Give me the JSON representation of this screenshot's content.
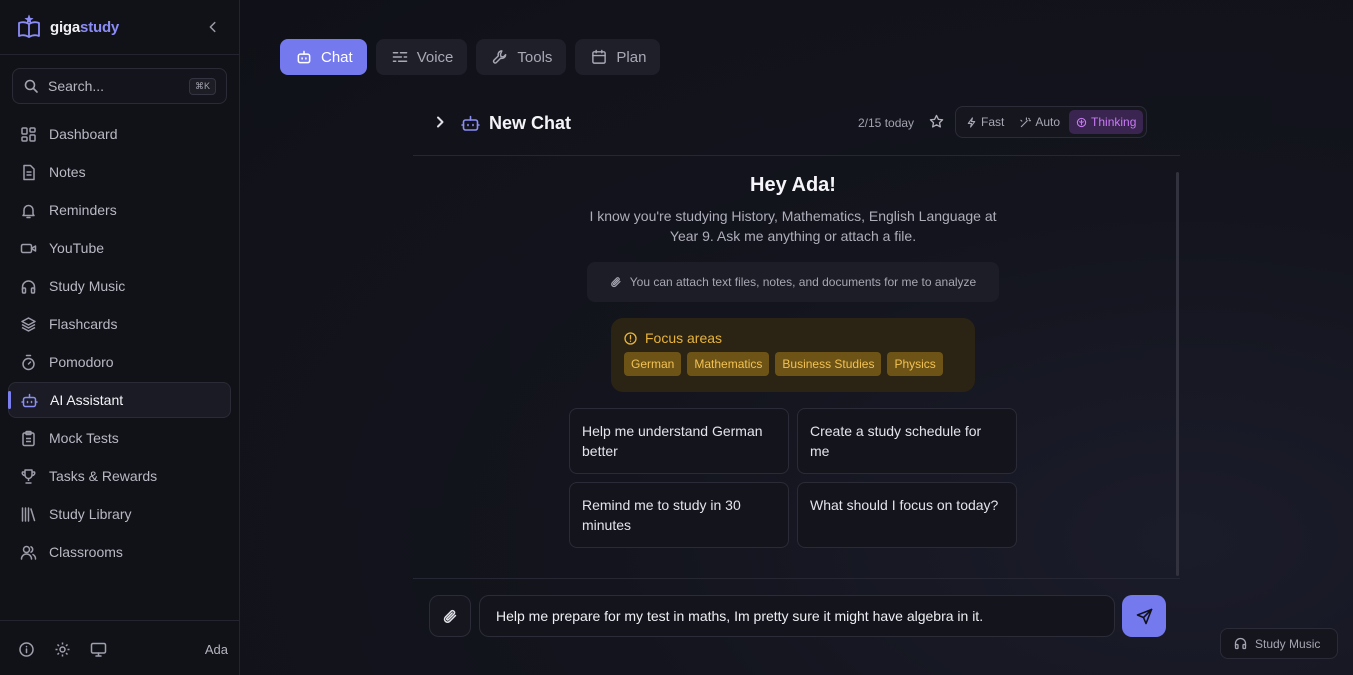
{
  "brand": {
    "part1": "giga",
    "part2": "study"
  },
  "search": {
    "placeholder": "Search...",
    "shortcut": "⌘K"
  },
  "sidebar": {
    "items": [
      {
        "label": "Dashboard",
        "icon": "dashboard-icon"
      },
      {
        "label": "Notes",
        "icon": "notes-icon"
      },
      {
        "label": "Reminders",
        "icon": "bell-icon"
      },
      {
        "label": "YouTube",
        "icon": "video-icon"
      },
      {
        "label": "Study Music",
        "icon": "headphones-icon"
      },
      {
        "label": "Flashcards",
        "icon": "layers-icon"
      },
      {
        "label": "Pomodoro",
        "icon": "timer-icon"
      },
      {
        "label": "AI Assistant",
        "icon": "bot-icon",
        "active": true
      },
      {
        "label": "Mock Tests",
        "icon": "clipboard-icon"
      },
      {
        "label": "Tasks & Rewards",
        "icon": "trophy-icon"
      },
      {
        "label": "Study Library",
        "icon": "library-icon"
      },
      {
        "label": "Classrooms",
        "icon": "users-icon"
      }
    ],
    "user": "Ada"
  },
  "mode_tabs": [
    {
      "label": "Chat",
      "icon": "bot-icon",
      "active": true
    },
    {
      "label": "Voice",
      "icon": "waves-icon"
    },
    {
      "label": "Tools",
      "icon": "wrench-icon"
    },
    {
      "label": "Plan",
      "icon": "calendar-icon"
    }
  ],
  "chat": {
    "title": "New Chat",
    "usage": "2/15 today",
    "speed_modes": [
      "Fast",
      "Auto",
      "Thinking"
    ],
    "active_speed": "Thinking",
    "greeting": "Hey Ada!",
    "intro": "I know you're studying History, Mathematics, English Language at Year 9. Ask me anything or attach a file.",
    "attach_hint": "You can attach text files, notes, and documents for me to analyze",
    "focus_title": "Focus areas",
    "focus_areas": [
      "German",
      "Mathematics",
      "Business Studies",
      "Physics"
    ],
    "suggestions": [
      "Help me understand German better",
      "Create a study schedule for me",
      "Remind me to study in 30 minutes",
      "What should I focus on today?"
    ],
    "input_value": "Help me prepare for my test in maths, Im pretty sure it might have algebra in it."
  },
  "music_pill": "Study Music",
  "colors": {
    "accent": "#7479ee",
    "thinking": "#c87af5",
    "focus": "#e8b33c"
  }
}
